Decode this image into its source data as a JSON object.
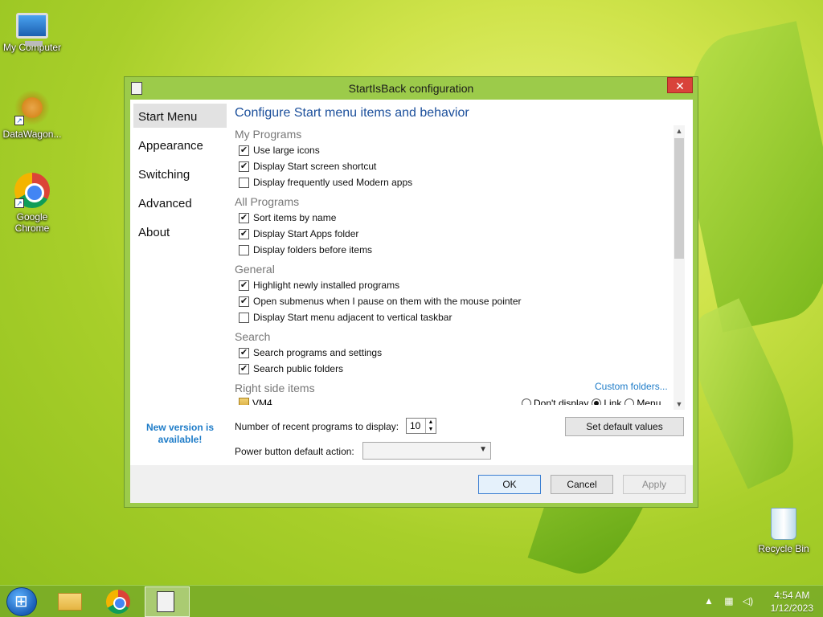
{
  "desktop": {
    "icons": [
      {
        "label": "My Computer",
        "icon": "computer-icon"
      },
      {
        "label": "DataWagon...",
        "icon": "datawagon-icon"
      },
      {
        "label": "Google Chrome",
        "icon": "chrome-icon"
      },
      {
        "label": "Recycle Bin",
        "icon": "recycle-bin-icon"
      }
    ]
  },
  "window": {
    "title": "StartIsBack configuration",
    "close_label": "✕",
    "sidebar": {
      "items": [
        {
          "label": "Start Menu",
          "active": true
        },
        {
          "label": "Appearance"
        },
        {
          "label": "Switching"
        },
        {
          "label": "Advanced"
        },
        {
          "label": "About"
        }
      ],
      "new_version": "New version is available!"
    },
    "heading": "Configure Start menu items and behavior",
    "groups": [
      {
        "title": "My Programs",
        "options": [
          {
            "label": "Use large icons",
            "checked": true
          },
          {
            "label": "Display Start screen shortcut",
            "checked": true
          },
          {
            "label": "Display frequently used Modern apps",
            "checked": false
          }
        ]
      },
      {
        "title": "All Programs",
        "options": [
          {
            "label": "Sort items by name",
            "checked": true
          },
          {
            "label": "Display Start Apps folder",
            "checked": true
          },
          {
            "label": "Display folders before items",
            "checked": false
          }
        ]
      },
      {
        "title": "General",
        "options": [
          {
            "label": "Highlight newly installed programs",
            "checked": true
          },
          {
            "label": "Open submenus when I pause on them with the mouse pointer",
            "checked": true
          },
          {
            "label": "Display Start menu adjacent to vertical taskbar",
            "checked": false
          }
        ]
      },
      {
        "title": "Search",
        "options": [
          {
            "label": "Search programs and settings",
            "checked": true
          },
          {
            "label": "Search public folders",
            "checked": true
          }
        ]
      }
    ],
    "right_side": {
      "title": "Right side items",
      "custom_folders_link": "Custom folders...",
      "item_name": "VM4",
      "radio_options": [
        {
          "label": "Don't display",
          "selected": false
        },
        {
          "label": "Link",
          "selected": true
        },
        {
          "label": "Menu",
          "selected": false
        }
      ]
    },
    "recent_programs_label": "Number of recent programs to display:",
    "recent_programs_value": "10",
    "set_default_label": "Set default values",
    "power_button_label": "Power button default action:",
    "power_button_value": "",
    "buttons": {
      "ok": "OK",
      "cancel": "Cancel",
      "apply": "Apply"
    }
  },
  "taskbar": {
    "time": "4:54 AM",
    "date": "1/12/2023",
    "tray_up_arrow": "▲",
    "network_icon": "network-icon",
    "volume_icon": "volume-icon"
  }
}
